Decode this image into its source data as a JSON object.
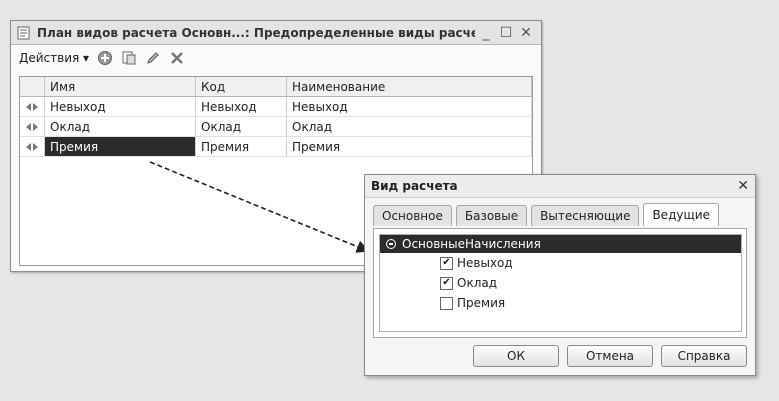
{
  "main_window": {
    "title": "План видов расчета Основн...: Предопределенные виды расчета",
    "minimize": "_",
    "maximize": "☐",
    "close": "✕",
    "toolbar": {
      "actions_label": "Действия ▾",
      "icons": [
        "add-icon",
        "copy-icon",
        "edit-icon",
        "delete-icon"
      ]
    },
    "table": {
      "columns": [
        "Имя",
        "Код",
        "Наименование"
      ],
      "rows": [
        {
          "name": "Невыход",
          "code": "Невыход",
          "title": "Невыход"
        },
        {
          "name": "Оклад",
          "code": "Оклад",
          "title": "Оклад"
        },
        {
          "name": "Премия",
          "code": "Премия",
          "title": "Премия"
        }
      ]
    }
  },
  "dialog": {
    "title": "Вид расчета",
    "close": "✕",
    "tabs": [
      "Основное",
      "Базовые",
      "Вытесняющие",
      "Ведущие"
    ],
    "active_tab": "Ведущие",
    "tree_root": "ОсновныеНачисления",
    "items": [
      {
        "label": "Невыход",
        "checked": true
      },
      {
        "label": "Оклад",
        "checked": true
      },
      {
        "label": "Премия",
        "checked": false
      }
    ],
    "buttons": {
      "ok": "ОК",
      "cancel": "Отмена",
      "help": "Справка"
    }
  },
  "colors": {
    "selection": "#2b2b2b",
    "background": "#e6e6e6"
  }
}
